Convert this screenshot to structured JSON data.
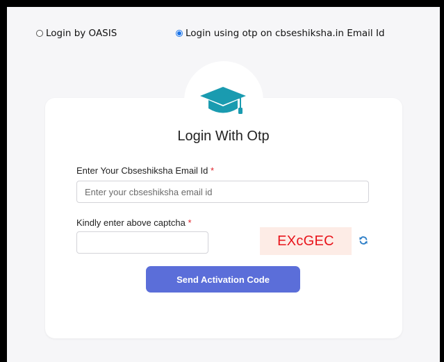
{
  "login_options": [
    {
      "label": "Login by OASIS",
      "selected": false
    },
    {
      "label": "Login using otp on cbseshiksha.in Email Id",
      "selected": true
    }
  ],
  "card": {
    "icon": "graduation-cap-icon",
    "title": "Login With Otp",
    "email": {
      "label": "Enter Your Cbseshiksha Email Id",
      "required_mark": "*",
      "placeholder": "Enter your cbseshiksha email id",
      "value": ""
    },
    "captcha": {
      "label": "Kindly enter above captcha",
      "required_mark": "*",
      "value": "",
      "code": "EXcGEC",
      "refresh_icon": "refresh-icon"
    },
    "submit_label": "Send Activation Code"
  },
  "colors": {
    "accent": "#5b6ed9",
    "icon": "#1a9bb0",
    "captcha_text": "#e8141b",
    "captcha_bg": "#fdece6",
    "required": "#e0222a"
  }
}
